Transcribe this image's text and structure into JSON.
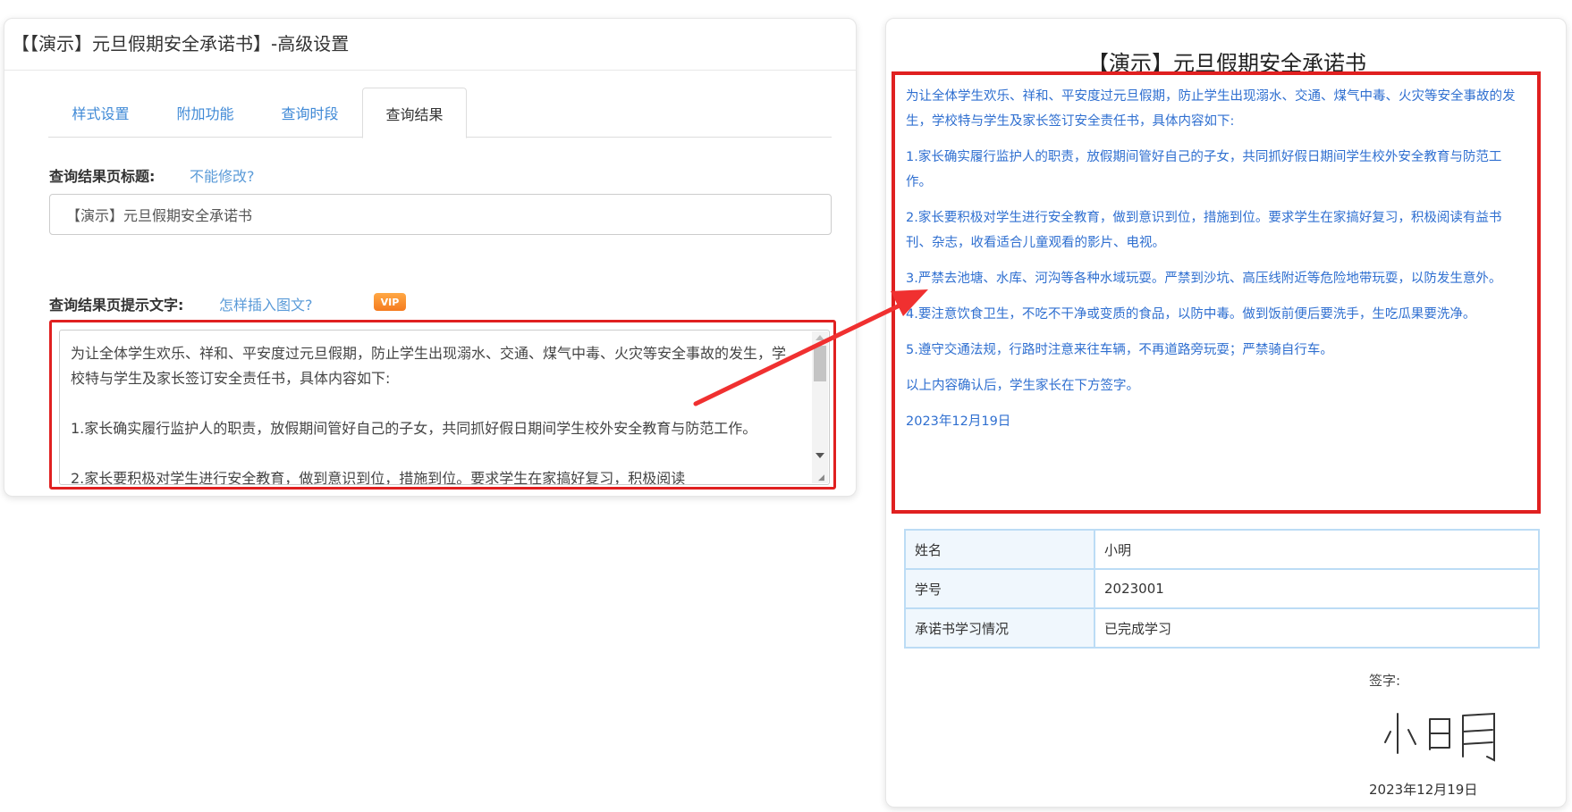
{
  "settings": {
    "header_title": "【【演示】元旦假期安全承诺书】-高级设置",
    "tabs": [
      {
        "label": "样式设置"
      },
      {
        "label": "附加功能"
      },
      {
        "label": "查询时段"
      },
      {
        "label": "查询结果"
      }
    ],
    "title_label": "查询结果页标题:",
    "title_link": "不能修改?",
    "title_value": "【演示】元旦假期安全承诺书",
    "tip_label": "查询结果页提示文字:",
    "tip_link": "怎样插入图文?",
    "vip_badge": "VIP",
    "textarea_lines": [
      "为让全体学生欢乐、祥和、平安度过元旦假期，防止学生出现溺水、交通、煤气中毒、火灾等安全事故的发生，学校特与学生及家长签订安全责任书，具体内容如下:",
      "",
      "1.家长确实履行监护人的职责，放假期间管好自己的子女，共同抓好假日期间学生校外安全教育与防范工作。",
      "",
      "2.家长要积极对学生进行安全教育，做到意识到位，措施到位。要求学生在家搞好复习，积极阅读"
    ]
  },
  "preview": {
    "title": "【演示】元旦假期安全承诺书",
    "paragraphs": [
      "为让全体学生欢乐、祥和、平安度过元旦假期，防止学生出现溺水、交通、煤气中毒、火灾等安全事故的发生，学校特与学生及家长签订安全责任书，具体内容如下:",
      "1.家长确实履行监护人的职责，放假期间管好自己的子女，共同抓好假日期间学生校外安全教育与防范工作。",
      "2.家长要积极对学生进行安全教育，做到意识到位，措施到位。要求学生在家搞好复习，积极阅读有益书刊、杂志，收看适合儿童观看的影片、电视。",
      "3.严禁去池塘、水库、河沟等各种水域玩耍。严禁到沙坑、高压线附近等危险地带玩耍，以防发生意外。",
      "4.要注意饮食卫生，不吃不干净或变质的食品，以防中毒。做到饭前便后要洗手，生吃瓜果要洗净。",
      "5.遵守交通法规，行路时注意来往车辆，不再道路旁玩耍；严禁骑自行车。",
      "以上内容确认后，学生家长在下方签字。",
      "2023年12月19日"
    ],
    "table": [
      {
        "key": "姓名",
        "value": "小明"
      },
      {
        "key": "学号",
        "value": "2023001"
      },
      {
        "key": "承诺书学习情况",
        "value": "已完成学习"
      }
    ],
    "sign_label": "签字:",
    "sign_name": "小明",
    "sign_date": "2023年12月19日"
  },
  "colors": {
    "highlight_border": "#e02020",
    "link_blue": "#3f89d6",
    "preview_text": "#2f6fd0",
    "table_border": "#bcdcf5"
  },
  "icons": [
    "arrow-annotation-icon",
    "scroll-up-icon",
    "scroll-down-icon",
    "resize-grip-icon"
  ]
}
